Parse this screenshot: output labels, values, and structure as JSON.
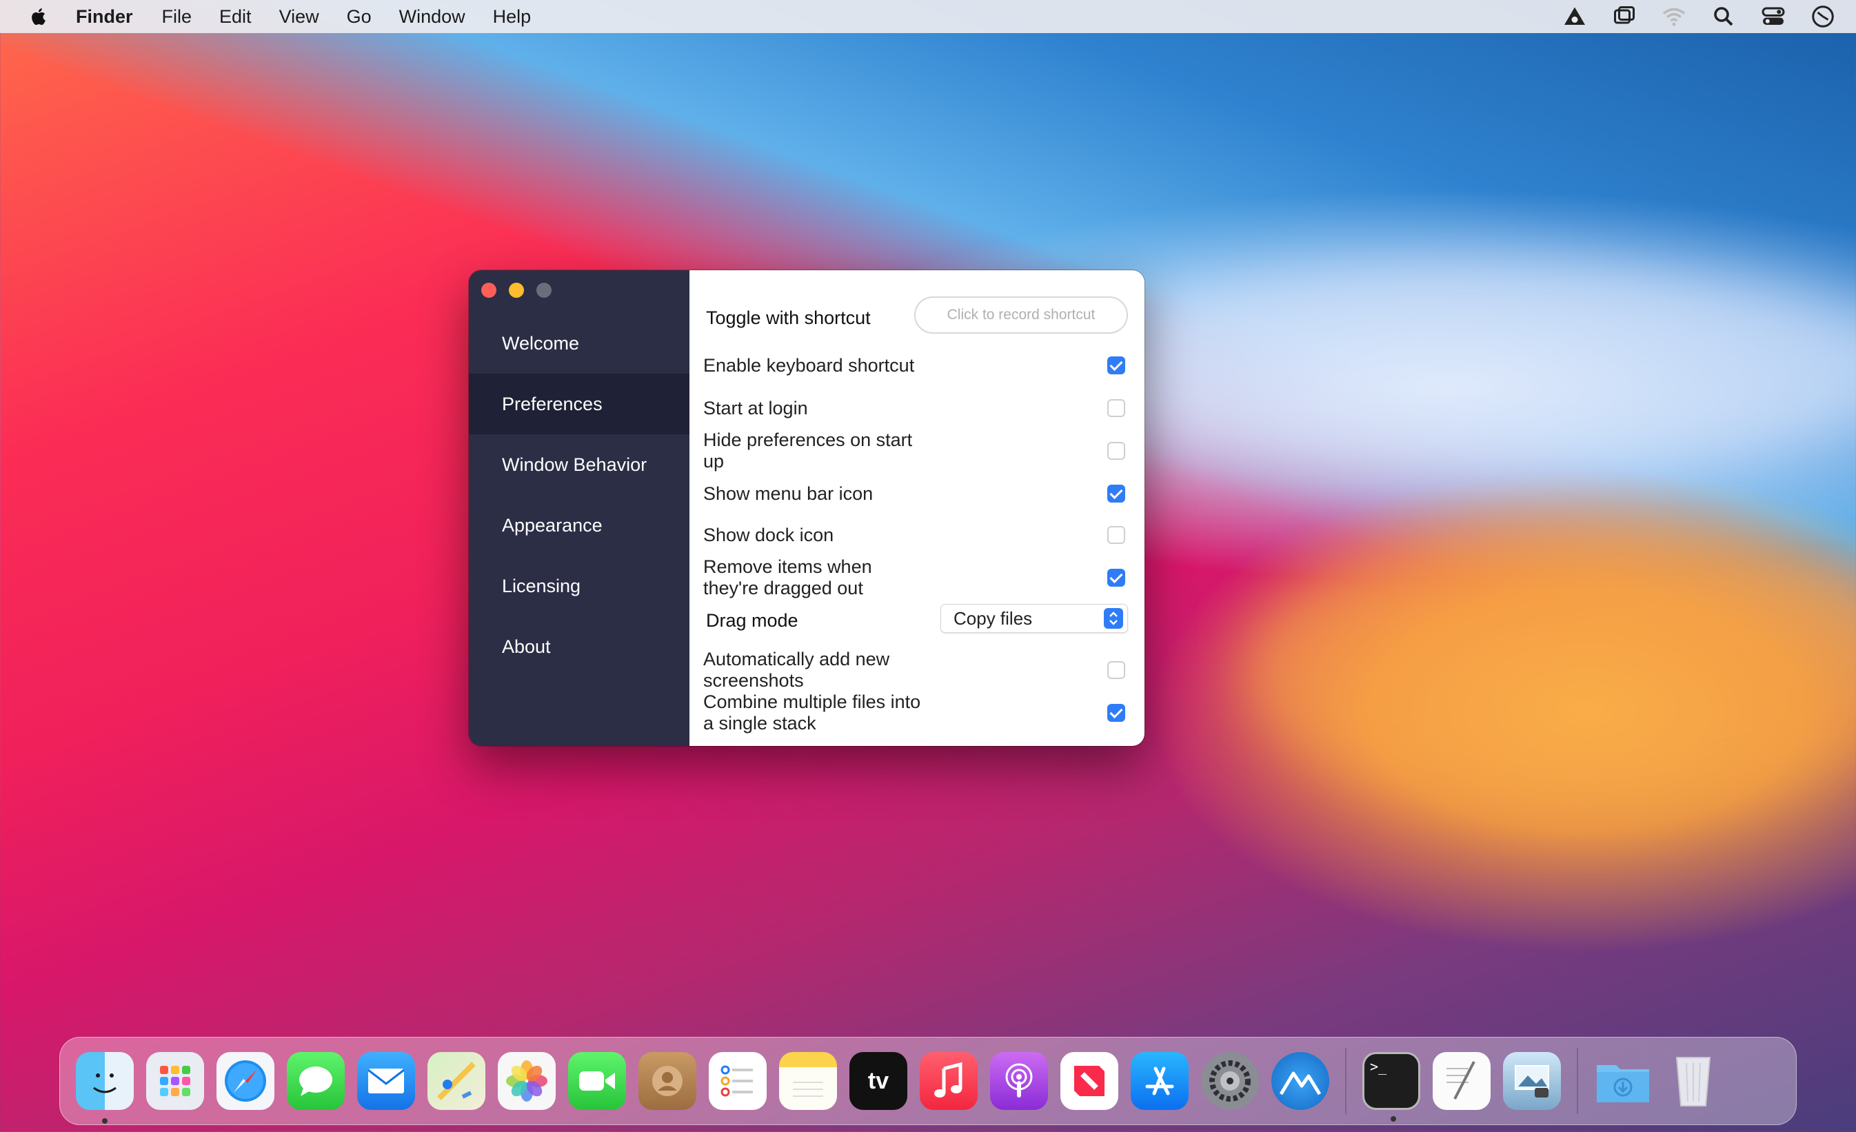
{
  "menubar": {
    "app_name": "Finder",
    "items": [
      "File",
      "Edit",
      "View",
      "Go",
      "Window",
      "Help"
    ],
    "status_icons": [
      "cloud-app-icon",
      "screen-mirroring-icon",
      "wifi-icon",
      "spotlight-search-icon",
      "control-center-icon",
      "clock-icon"
    ]
  },
  "window": {
    "sidebar": {
      "items": [
        "Welcome",
        "Preferences",
        "Window Behavior",
        "Appearance",
        "Licensing",
        "About"
      ],
      "active": "Preferences"
    },
    "preferences": {
      "toggle_shortcut_label": "Toggle with shortcut",
      "shortcut_placeholder": "Click to record shortcut",
      "options": [
        {
          "label": "Enable keyboard shortcut",
          "checked": true
        },
        {
          "label": "Start at login",
          "checked": false
        },
        {
          "label": "Hide preferences on start up",
          "checked": false
        },
        {
          "label": "Show menu bar icon",
          "checked": true
        },
        {
          "label": "Show dock icon",
          "checked": false
        },
        {
          "label": "Remove items when they're dragged out",
          "checked": true
        }
      ],
      "drag_mode_label": "Drag mode",
      "drag_mode_value": "Copy files",
      "options2": [
        {
          "label": "Automatically add new screenshots",
          "checked": false
        },
        {
          "label": "Combine multiple files into a single stack",
          "checked": true
        }
      ]
    }
  },
  "dock": {
    "apps": [
      "finder",
      "launchpad",
      "safari",
      "messages",
      "mail",
      "maps",
      "photos",
      "facetime",
      "contacts",
      "reminders",
      "notes",
      "apple-tv",
      "music",
      "podcasts",
      "news",
      "app-store",
      "system-preferences",
      "yoink"
    ],
    "apps2": [
      "terminal",
      "textedit",
      "preview"
    ],
    "apps3": [
      "downloads",
      "trash"
    ],
    "tv_label": "tv"
  },
  "colors": {
    "accent": "#2f7cf6",
    "sidebar": "#2b2e45",
    "sidebar_active": "#1f2236"
  }
}
